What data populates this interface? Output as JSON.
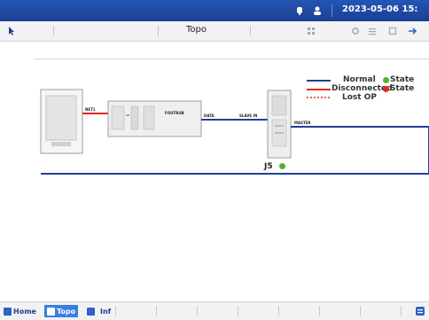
{
  "status_bar": {
    "datetime": "2023-05-06 15:",
    "icons": [
      "bell-icon",
      "user-icon"
    ]
  },
  "title_bar": {
    "title": "Topo",
    "icons": [
      "pointer-icon",
      "grid-icon",
      "settings-icon",
      "list-icon",
      "expand-icon",
      "arrow-icon"
    ]
  },
  "legend": {
    "normal": "Normal",
    "disconnected": "Disconnected",
    "lost": "Lost OP",
    "state_label": "State",
    "colors": {
      "normal": "#1f3f9c",
      "disconnected": "#e0281e",
      "lost": "#e0281e",
      "ok": "#58b12f",
      "fault": "#e0281e"
    }
  },
  "topology": {
    "device_label": "J5",
    "port_net1": "NET1",
    "port_data": "DATA",
    "port_slave": "SLAVE IN",
    "port_master": "MASTER",
    "module_text": "FOUTRUB"
  },
  "bottom_nav": {
    "tabs": [
      {
        "label": "Home",
        "icon": "home-icon"
      },
      {
        "label": "Topo",
        "icon": "topology-icon",
        "active": true
      },
      {
        "label": "Inf",
        "icon": "info-icon"
      }
    ]
  }
}
